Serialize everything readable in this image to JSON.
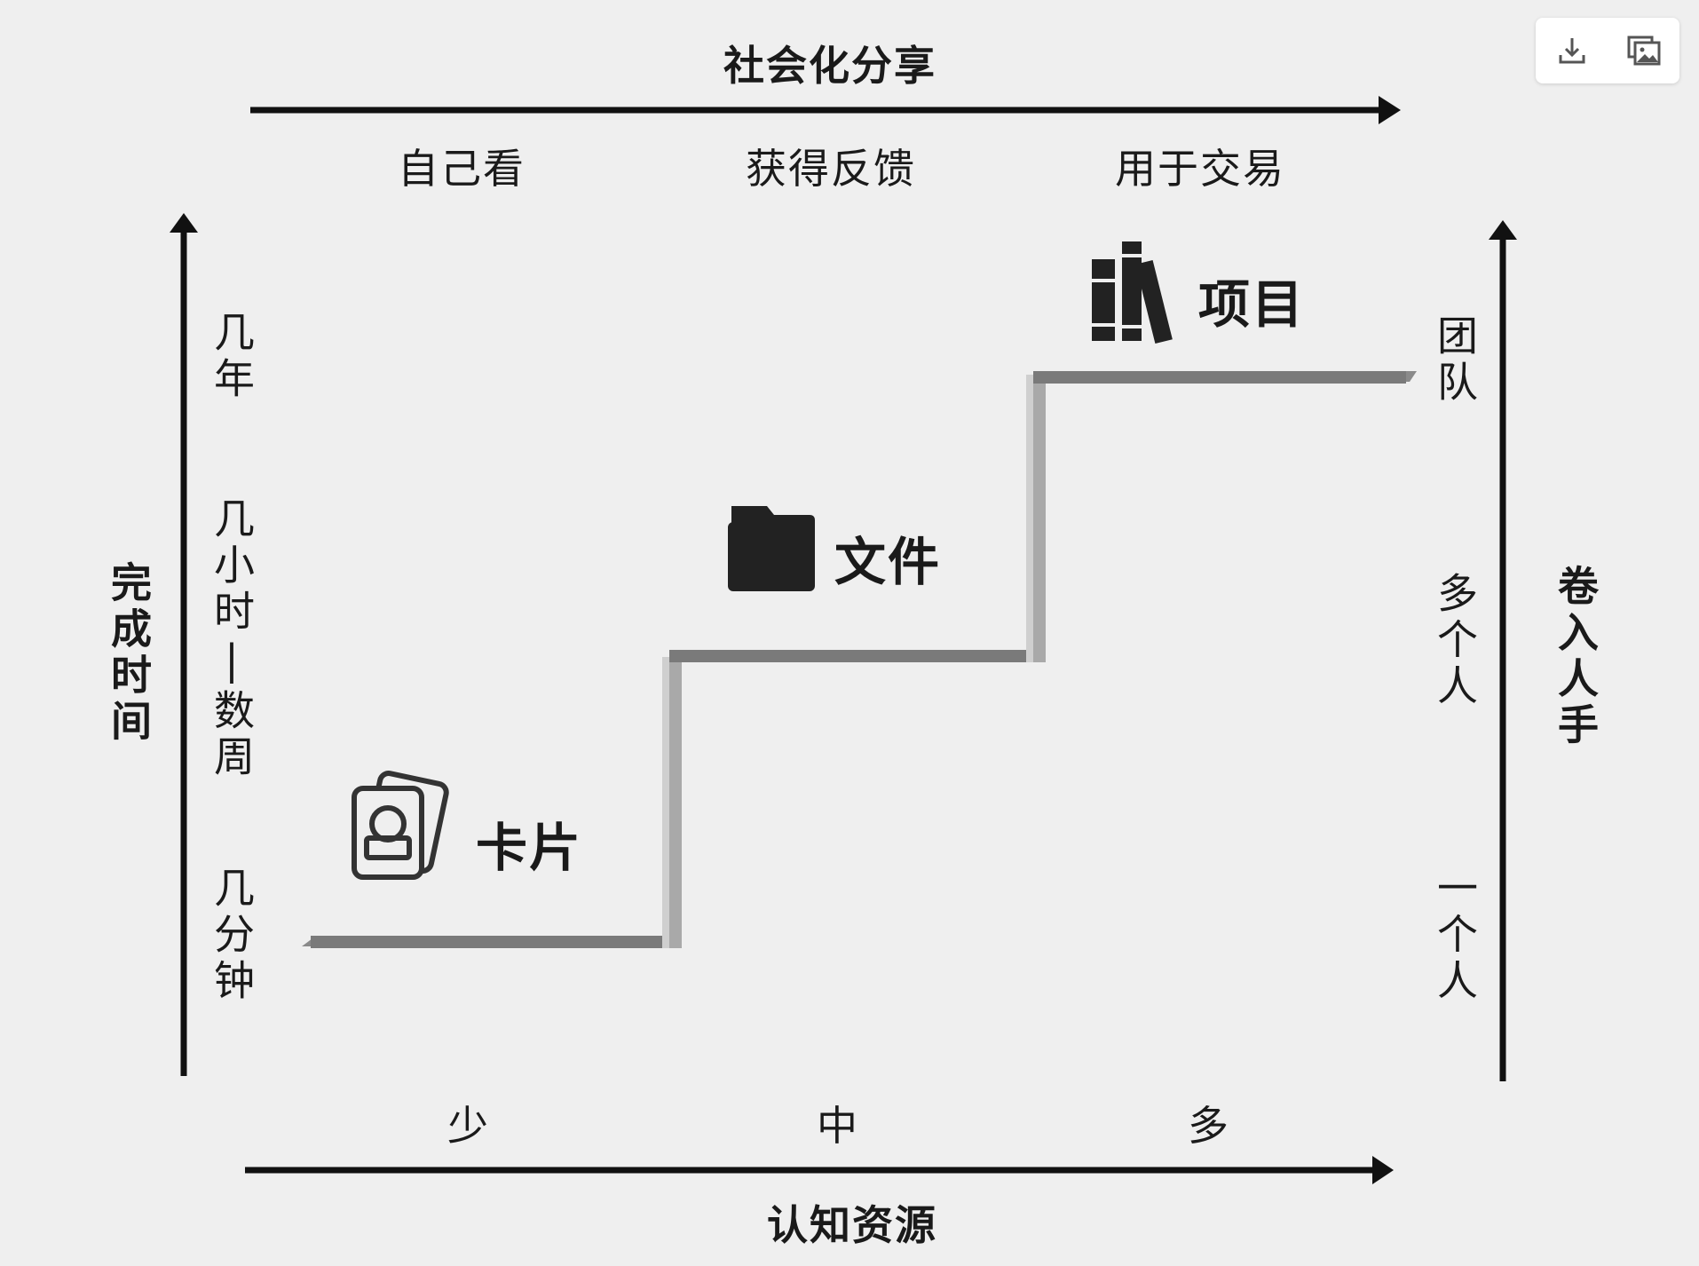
{
  "top_axis": {
    "title": "社会化分享",
    "stages": [
      "自己看",
      "获得反馈",
      "用于交易"
    ]
  },
  "bottom_axis": {
    "title": "认知资源",
    "stages": [
      "少",
      "中",
      "多"
    ]
  },
  "left_axis": {
    "title": "完成时间",
    "stages": [
      "几年",
      "几小时|数周",
      "几分钟"
    ]
  },
  "right_axis": {
    "title": "卷入人手",
    "stages": [
      "团队",
      "多个人",
      "一个人"
    ]
  },
  "steps": [
    {
      "label": "卡片",
      "icon": "cards-icon"
    },
    {
      "label": "文件",
      "icon": "folder-icon"
    },
    {
      "label": "项目",
      "icon": "books-icon"
    }
  ],
  "colors": {
    "background": "#efefef",
    "axis": "#111111",
    "stair_top": "#7a7a7a",
    "stair_side": "#a9a9a9"
  },
  "toolbar": {
    "download_icon": "download-icon",
    "image_icon": "image-icon"
  }
}
